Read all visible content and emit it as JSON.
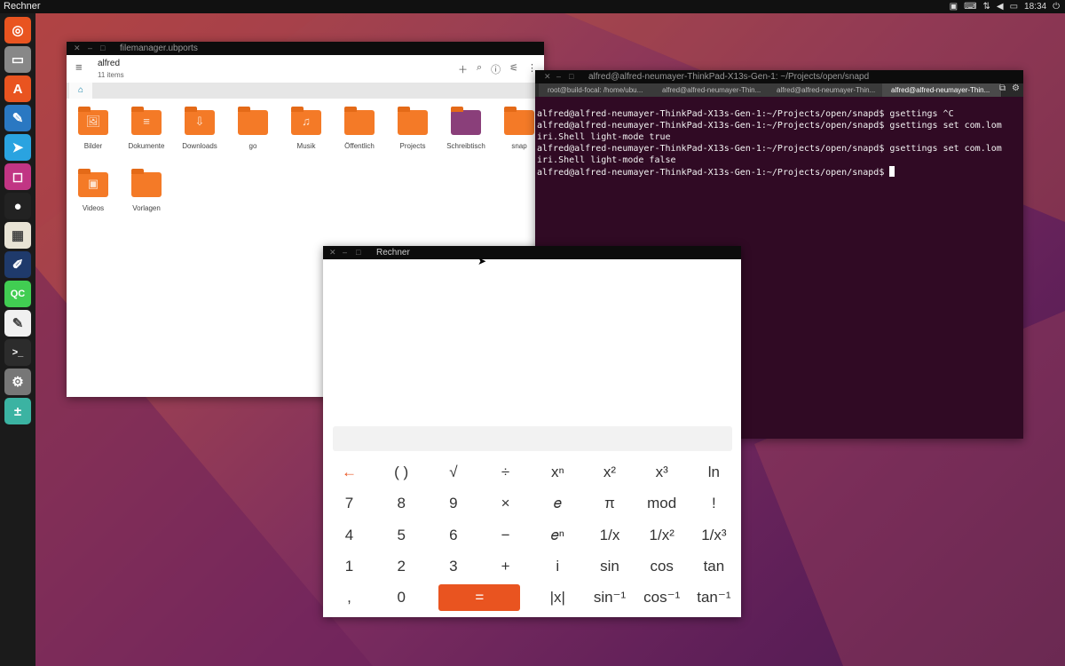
{
  "top_panel": {
    "app_title": "Rechner",
    "clock": "18:34",
    "indicators": [
      "camera-icon",
      "keyboard-icon",
      "network-icon",
      "volume-icon",
      "battery-icon",
      "power-icon"
    ]
  },
  "launcher": {
    "items": [
      {
        "name": "ubuntu-icon",
        "glyph": "◎",
        "color": "#e95420"
      },
      {
        "name": "files-icon",
        "glyph": "▭",
        "color": "#888888"
      },
      {
        "name": "store-icon",
        "glyph": "A",
        "color": "#e95420"
      },
      {
        "name": "feather-icon",
        "glyph": "✎",
        "color": "#2a78c2"
      },
      {
        "name": "telegram-icon",
        "glyph": "➤",
        "color": "#2aa3e0"
      },
      {
        "name": "instagram-icon",
        "glyph": "◻",
        "color": "#c13584"
      },
      {
        "name": "traffic-light-icon",
        "glyph": "●",
        "color": "#222222"
      },
      {
        "name": "calculator-app-icon",
        "glyph": "▦",
        "color": "#e8e3d5"
      },
      {
        "name": "editor-icon",
        "glyph": "✐",
        "color": "#1f3a6b"
      },
      {
        "name": "qt-creator-icon",
        "glyph": "QC",
        "color": "#41cd52"
      },
      {
        "name": "notes-icon",
        "glyph": "✎",
        "color": "#f0f0f0"
      },
      {
        "name": "terminal-app-icon",
        "glyph": ">_",
        "color": "#2c2c2c"
      },
      {
        "name": "settings-app-icon",
        "glyph": "⚙",
        "color": "#777777"
      },
      {
        "name": "rechner-app-icon",
        "glyph": "±",
        "color": "#3bb3a2"
      }
    ]
  },
  "file_manager": {
    "window_title": "filemanager.ubports",
    "folder_name": "alfred",
    "item_count": "11 items",
    "folders": [
      {
        "label": "Bilder",
        "glyph": "🖼"
      },
      {
        "label": "Dokumente",
        "glyph": "≡"
      },
      {
        "label": "Downloads",
        "glyph": "⇩"
      },
      {
        "label": "go",
        "glyph": ""
      },
      {
        "label": "Musik",
        "glyph": "♫"
      },
      {
        "label": "Öffentlich",
        "glyph": ""
      },
      {
        "label": "Projects",
        "glyph": ""
      },
      {
        "label": "Schreibtisch",
        "glyph": ""
      },
      {
        "label": "snap",
        "glyph": ""
      },
      {
        "label": "Videos",
        "glyph": "▣"
      },
      {
        "label": "Vorlagen",
        "glyph": ""
      }
    ]
  },
  "terminal": {
    "window_title": "alfred@alfred-neumayer-ThinkPad-X13s-Gen-1: ~/Projects/open/snapd",
    "tabs": [
      "root@build-focal: /home/ubu...",
      "alfred@alfred-neumayer-Thin...",
      "alfred@alfred-neumayer-Thin...",
      "alfred@alfred-neumayer-Thin..."
    ],
    "lines": [
      "alfred@alfred-neumayer-ThinkPad-X13s-Gen-1:~/Projects/open/snapd$ gsettings ^C",
      "alfred@alfred-neumayer-ThinkPad-X13s-Gen-1:~/Projects/open/snapd$ gsettings set com.lom",
      "iri.Shell light-mode true",
      "alfred@alfred-neumayer-ThinkPad-X13s-Gen-1:~/Projects/open/snapd$ gsettings set com.lom",
      "iri.Shell light-mode false",
      "alfred@alfred-neumayer-ThinkPad-X13s-Gen-1:~/Projects/open/snapd$ "
    ]
  },
  "calculator": {
    "window_title": "Rechner",
    "rows": [
      [
        "←",
        "( )",
        "√",
        "÷",
        "xⁿ",
        "x²",
        "x³",
        "ln"
      ],
      [
        "7",
        "8",
        "9",
        "×",
        "𝑒",
        "π",
        "mod",
        "!"
      ],
      [
        "4",
        "5",
        "6",
        "−",
        "𝑒ⁿ",
        "1/x",
        "1/x²",
        "1/x³"
      ],
      [
        "1",
        "2",
        "3",
        "+",
        "i",
        "sin",
        "cos",
        "tan"
      ],
      [
        ",",
        "0",
        "=",
        "|x|",
        "sin⁻¹",
        "cos⁻¹",
        "tan⁻¹"
      ]
    ],
    "accent_color": "#e95420"
  }
}
